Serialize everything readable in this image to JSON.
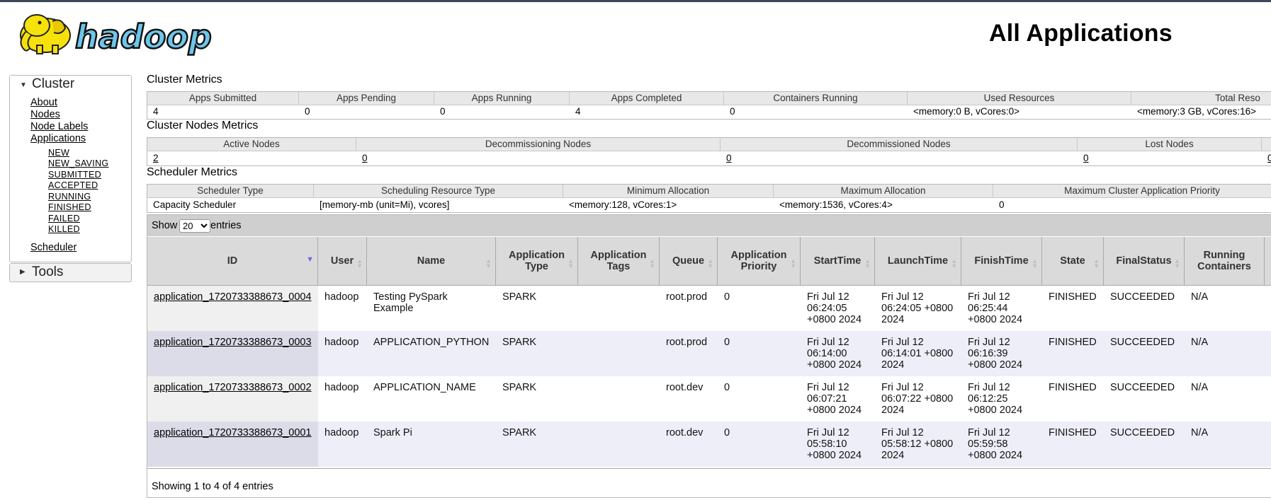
{
  "page": {
    "title": "All Applications",
    "logo_alt": "hadoop"
  },
  "sidebar": {
    "cluster": {
      "label": "Cluster",
      "links": [
        "About",
        "Nodes",
        "Node Labels",
        "Applications"
      ],
      "states": [
        "NEW",
        "NEW_SAVING",
        "SUBMITTED",
        "ACCEPTED",
        "RUNNING",
        "FINISHED",
        "FAILED",
        "KILLED"
      ],
      "scheduler": "Scheduler"
    },
    "tools": {
      "label": "Tools"
    }
  },
  "cluster_metrics": {
    "title": "Cluster Metrics",
    "headers": [
      "Apps Submitted",
      "Apps Pending",
      "Apps Running",
      "Apps Completed",
      "Containers Running",
      "Used Resources",
      "Total Reso"
    ],
    "values": [
      "4",
      "0",
      "0",
      "4",
      "0",
      "<memory:0 B, vCores:0>",
      "<memory:3 GB, vCores:16>"
    ]
  },
  "node_metrics": {
    "title": "Cluster Nodes Metrics",
    "headers": [
      "Active Nodes",
      "Decommissioning Nodes",
      "Decommissioned Nodes",
      "Lost Nodes"
    ],
    "values": [
      "2",
      "0",
      "0",
      "0",
      "0"
    ]
  },
  "scheduler_metrics": {
    "title": "Scheduler Metrics",
    "headers": [
      "Scheduler Type",
      "Scheduling Resource Type",
      "Minimum Allocation",
      "Maximum Allocation",
      "Maximum Cluster Application Priority"
    ],
    "values": [
      "Capacity Scheduler",
      "[memory-mb (unit=Mi), vcores]",
      "<memory:128, vCores:1>",
      "<memory:1536, vCores:4>",
      "0"
    ]
  },
  "apps_table": {
    "show_label": "Show",
    "entries_label": "entries",
    "page_size": "20",
    "columns": [
      "ID",
      "User",
      "Name",
      "Application Type",
      "Application Tags",
      "Queue",
      "Application Priority",
      "StartTime",
      "LaunchTime",
      "FinishTime",
      "State",
      "FinalStatus",
      "Running Containers"
    ],
    "rows": [
      {
        "id": "application_1720733388673_0004",
        "user": "hadoop",
        "name": "Testing PySpark Example",
        "type": "SPARK",
        "tags": "",
        "queue": "root.prod",
        "priority": "0",
        "start": "Fri Jul 12 06:24:05 +0800 2024",
        "launch": "Fri Jul 12 06:24:05 +0800 2024",
        "finish": "Fri Jul 12 06:25:44 +0800 2024",
        "state": "FINISHED",
        "final": "SUCCEEDED",
        "containers": "N/A"
      },
      {
        "id": "application_1720733388673_0003",
        "user": "hadoop",
        "name": "APPLICATION_PYTHON",
        "type": "SPARK",
        "tags": "",
        "queue": "root.prod",
        "priority": "0",
        "start": "Fri Jul 12 06:14:00 +0800 2024",
        "launch": "Fri Jul 12 06:14:01 +0800 2024",
        "finish": "Fri Jul 12 06:16:39 +0800 2024",
        "state": "FINISHED",
        "final": "SUCCEEDED",
        "containers": "N/A"
      },
      {
        "id": "application_1720733388673_0002",
        "user": "hadoop",
        "name": "APPLICATION_NAME",
        "type": "SPARK",
        "tags": "",
        "queue": "root.dev",
        "priority": "0",
        "start": "Fri Jul 12 06:07:21 +0800 2024",
        "launch": "Fri Jul 12 06:07:22 +0800 2024",
        "finish": "Fri Jul 12 06:12:25 +0800 2024",
        "state": "FINISHED",
        "final": "SUCCEEDED",
        "containers": "N/A"
      },
      {
        "id": "application_1720733388673_0001",
        "user": "hadoop",
        "name": "Spark Pi",
        "type": "SPARK",
        "tags": "",
        "queue": "root.dev",
        "priority": "0",
        "start": "Fri Jul 12 05:58:10 +0800 2024",
        "launch": "Fri Jul 12 05:58:12 +0800 2024",
        "finish": "Fri Jul 12 05:59:58 +0800 2024",
        "state": "FINISHED",
        "final": "SUCCEEDED",
        "containers": "N/A"
      }
    ],
    "footer": "Showing 1 to 4 of 4 entries"
  },
  "colors": {
    "header_gray": "#e8e8e8",
    "row_alt": "#eeeef8",
    "logo_yellow": "#f6e20a",
    "logo_blue": "#6ec6ea"
  }
}
